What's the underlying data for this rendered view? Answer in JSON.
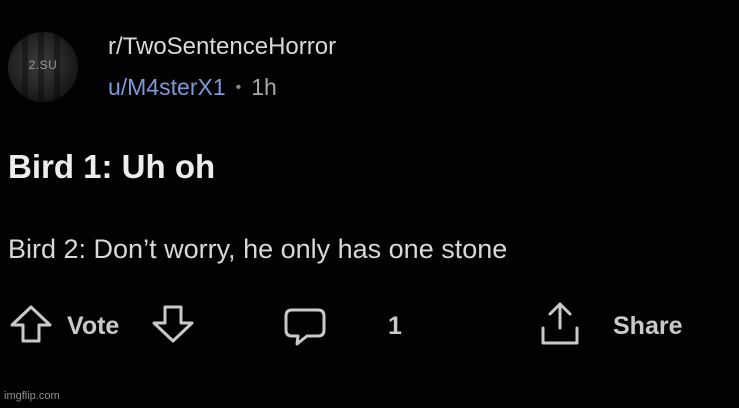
{
  "post": {
    "avatar_text": "2.SU",
    "subreddit": "r/TwoSentenceHorror",
    "username": "u/M4sterX1",
    "separator": "•",
    "time": "1h",
    "title": "Bird 1: Uh oh",
    "body": "Bird 2: Don’t worry, he only has one stone"
  },
  "actions": {
    "vote_label": "Vote",
    "comment_count": "1",
    "share_label": "Share"
  },
  "watermark": "imgflip.com",
  "colors": {
    "background": "#020202",
    "username": "#7f98d8",
    "text": "#d8d8d8"
  },
  "icons": {
    "upvote": "arrow-up-icon",
    "downvote": "arrow-down-icon",
    "comment": "comment-bubble-icon",
    "share": "share-icon"
  }
}
